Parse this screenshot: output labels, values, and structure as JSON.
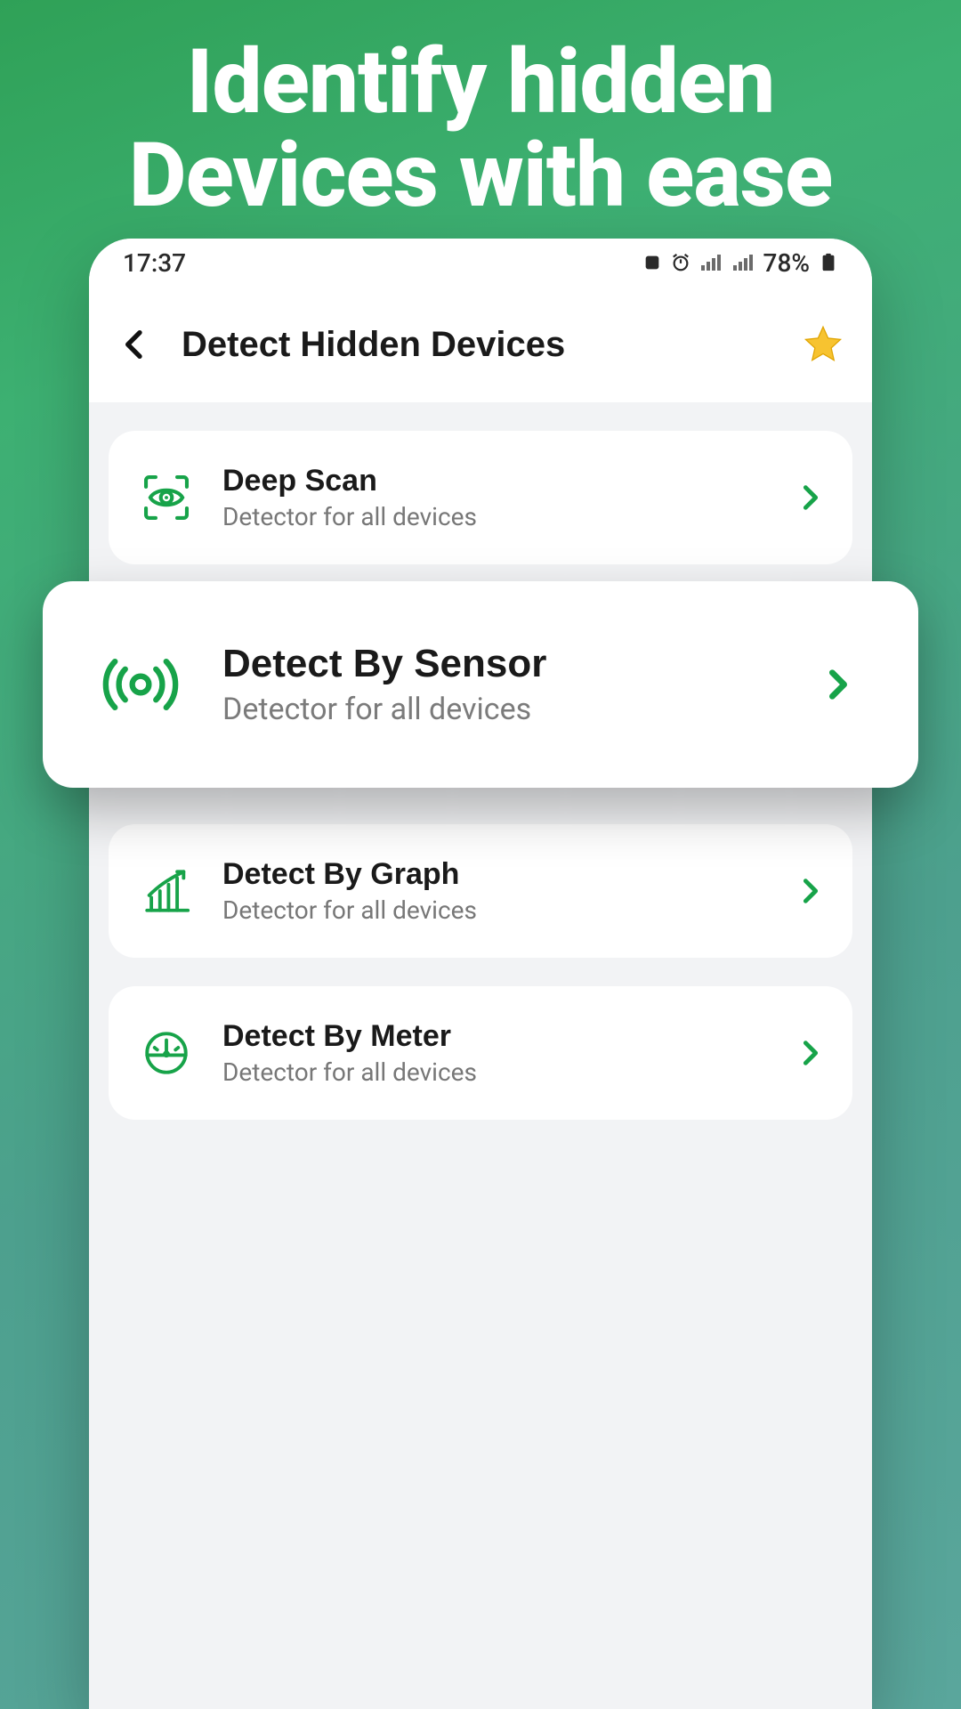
{
  "promo": {
    "line1": "Identify hidden",
    "line2": "Devices with ease"
  },
  "status": {
    "time": "17:37",
    "battery": "78%"
  },
  "header": {
    "title": "Detect Hidden Devices"
  },
  "items": [
    {
      "icon": "eye-scan",
      "title": "Deep Scan",
      "subtitle": "Detector for all devices"
    },
    {
      "icon": "sensor",
      "title": "Detect By Sensor",
      "subtitle": "Detector for all devices"
    },
    {
      "icon": "graph",
      "title": "Detect By Graph",
      "subtitle": "Detector for all devices"
    },
    {
      "icon": "meter",
      "title": "Detect By Meter",
      "subtitle": "Detector for all devices"
    }
  ],
  "colors": {
    "accent": "#17a349"
  }
}
